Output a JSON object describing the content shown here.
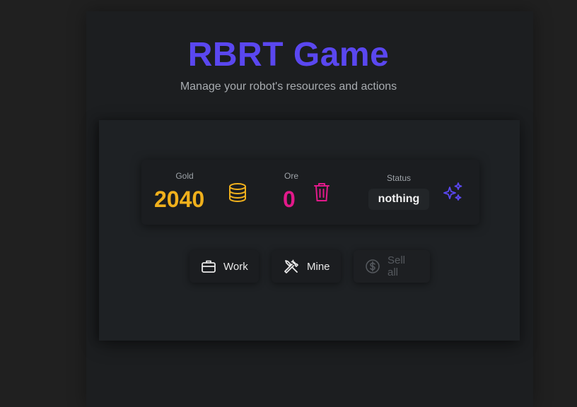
{
  "header": {
    "title": "RBRT Game",
    "subtitle": "Manage your robot's resources and actions",
    "accent_color": "#5a47f0"
  },
  "stats": {
    "gold": {
      "label": "Gold",
      "value": "2040",
      "icon": "coins-icon",
      "color": "#f0b01c"
    },
    "ore": {
      "label": "Ore",
      "value": "0",
      "icon": "trash-icon",
      "color": "#e2198a"
    },
    "status": {
      "label": "Status",
      "value": "nothing",
      "icon": "sparkles-icon",
      "color": "#5a47f0"
    }
  },
  "actions": {
    "work": {
      "label": "Work",
      "icon": "briefcase-icon",
      "enabled": true
    },
    "mine": {
      "label": "Mine",
      "icon": "tools-icon",
      "enabled": true
    },
    "sell_all": {
      "label": "Sell all",
      "icon": "dollar-circle-icon",
      "enabled": false
    }
  }
}
